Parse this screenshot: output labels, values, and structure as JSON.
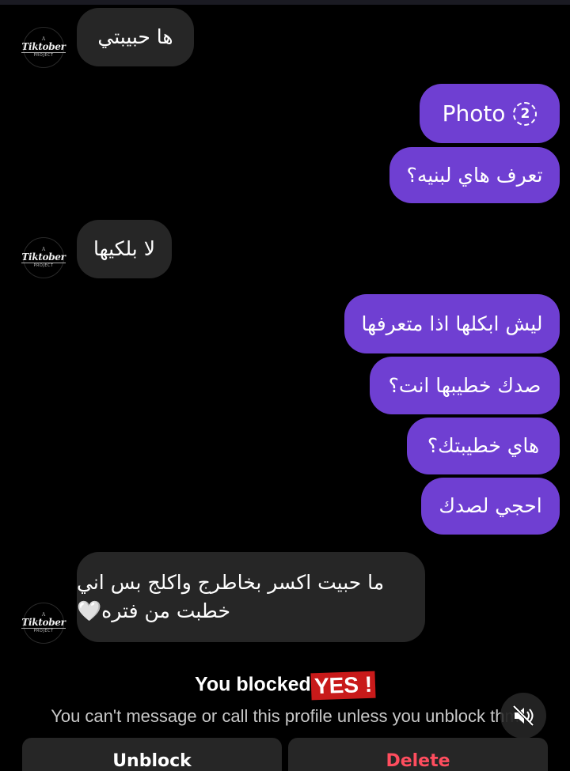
{
  "messages": [
    {
      "side": "received",
      "text": "ها حبيبتي"
    },
    {
      "side": "sent",
      "type": "photo",
      "text": "Photo",
      "count": "2"
    },
    {
      "side": "sent",
      "text": "تعرف هاي لبنيه؟"
    },
    {
      "side": "received",
      "text": "لا بلكيها"
    },
    {
      "side": "sent",
      "text": "ليش ابكلها اذا متعرفها"
    },
    {
      "side": "sent",
      "text": "صدك خطيبها انت؟"
    },
    {
      "side": "sent",
      "text": "هاي خطيبتك؟"
    },
    {
      "side": "sent",
      "text": "احجي لصدك"
    },
    {
      "side": "received",
      "text_line1": "ما حبيت اكسر بخاطرج واكلج بس اني",
      "text_line2": "خطبت من فتره",
      "emoji": "🤍"
    }
  ],
  "avatar": {
    "top": "A",
    "name": "Tiktober",
    "sub": "PROJECT"
  },
  "blocked": {
    "title": "You blocked",
    "sticker": "YES !",
    "subtitle": "You can't message or call this profile unless you unblock th",
    "subtitle_tail": "m"
  },
  "buttons": {
    "unblock": "Unblock",
    "delete": "Delete"
  },
  "colors": {
    "sent": "#6f3fd2",
    "received": "#262626",
    "background": "#000000",
    "sticker": "#c81a1a"
  }
}
